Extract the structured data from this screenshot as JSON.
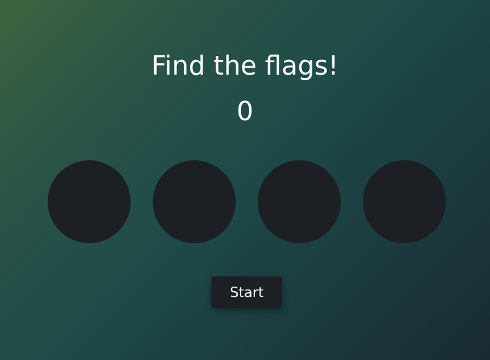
{
  "game": {
    "title": "Find the flags!",
    "score": "0",
    "circles": [
      {
        "id": 1
      },
      {
        "id": 2
      },
      {
        "id": 3
      },
      {
        "id": 4
      }
    ],
    "start_label": "Start"
  },
  "colors": {
    "circle": "#1c1f24",
    "button": "#1c1f24",
    "text": "#ffffff",
    "background_start": "#3f643e",
    "background_end": "#1a2a33"
  }
}
